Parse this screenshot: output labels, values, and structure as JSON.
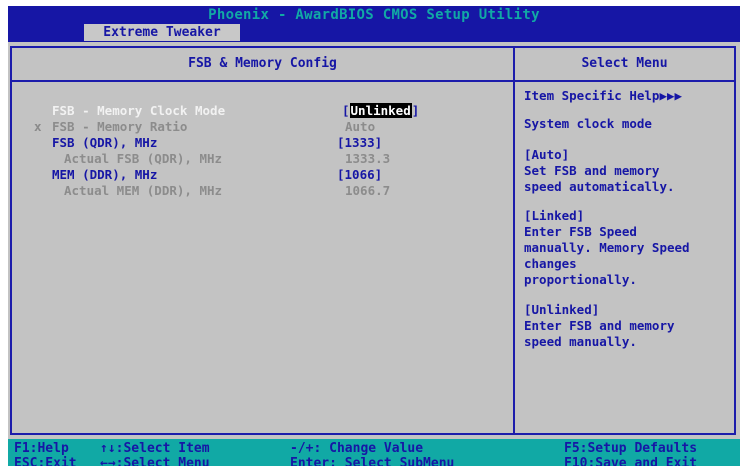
{
  "title": "Phoenix - AwardBIOS CMOS Setup Utility",
  "tab": "Extreme Tweaker",
  "left_header": "FSB & Memory Config",
  "right_header": "Select Menu",
  "settings": [
    {
      "marker": "",
      "label": "FSB - Memory Clock Mode",
      "value": "Unlinked",
      "bracketed": true,
      "selected": true
    },
    {
      "marker": "x",
      "label": "FSB - Memory Ratio",
      "value": "Auto",
      "bracketed": false
    },
    {
      "marker": "",
      "label": "FSB (QDR), MHz",
      "value": "[1333]",
      "bracketed": false
    },
    {
      "marker": "",
      "label": "Actual FSB (QDR), MHz",
      "value": "1333.3",
      "bracketed": false
    },
    {
      "marker": "",
      "label": "MEM (DDR), MHz",
      "value": "[1066]",
      "bracketed": false
    },
    {
      "marker": "",
      "label": "Actual MEM (DDR), MHz",
      "value": "1066.7",
      "bracketed": false
    }
  ],
  "help": [
    "Item Specific Help▶▶▶",
    "System clock mode",
    "[Auto]",
    "Set FSB and memory",
    "speed automatically.",
    "[Linked]",
    "Enter FSB Speed",
    "manually. Memory Speed",
    "changes",
    "proportionally.",
    "[Unlinked]",
    "Enter FSB and memory",
    "speed manually."
  ],
  "footer": {
    "f1": "F1:Help",
    "esc": "ESC:Exit",
    "select_item": "↑↓:Select Item",
    "select_menu": "←→:Select Menu",
    "change_value": "-/+: Change Value",
    "enter": "Enter: Select SubMenu",
    "f5": "F5:Setup Defaults",
    "f10": "F10:Save and Exit"
  },
  "colors": {
    "background": "#c3c3c3",
    "bar": "#1616a5",
    "accent": "#11a9a5",
    "selected_bg": "#000000"
  }
}
